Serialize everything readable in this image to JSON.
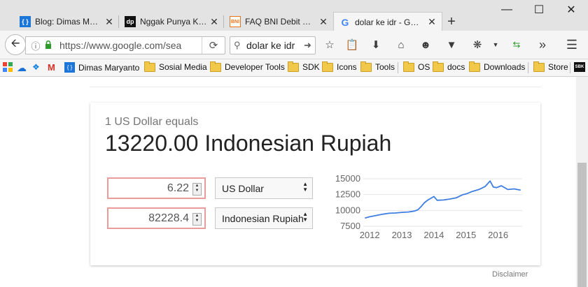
{
  "browser": {
    "tabs": [
      {
        "title": "Blog: Dimas M…",
        "favicon": "brackets-icon",
        "active": false
      },
      {
        "title": "Nggak Punya K…",
        "favicon": "dp-logo-icon",
        "active": false
      },
      {
        "title": "FAQ BNI Debit …",
        "favicon": "bni-logo-icon",
        "active": false
      },
      {
        "title": "dolar ke idr - G…",
        "favicon": "google-g-icon",
        "active": true
      }
    ],
    "url": "https://www.google.com/sea",
    "search_query": "dolar ke idr",
    "window_controls": {
      "minimize": "—",
      "maximize": "☐",
      "close": "✕"
    }
  },
  "bookmarks": [
    {
      "label": "Dimas Maryanto",
      "type": "site"
    },
    {
      "label": "Sosial Media",
      "type": "folder"
    },
    {
      "label": "Developer Tools",
      "type": "folder"
    },
    {
      "label": "SDK",
      "type": "folder"
    },
    {
      "label": "Icons",
      "type": "folder"
    },
    {
      "label": "Tools",
      "type": "folder"
    },
    {
      "label": "OS",
      "type": "folder"
    },
    {
      "label": "docs",
      "type": "folder"
    },
    {
      "label": "Downloads",
      "type": "folder"
    },
    {
      "label": "Store",
      "type": "folder"
    }
  ],
  "converter": {
    "equals_text": "1 US Dollar equals",
    "result_text": "13220.00 Indonesian Rupiah",
    "from_amount": "6.22",
    "from_currency": "US Dollar",
    "to_amount": "82228.4",
    "to_currency": "Indonesian Rupiah",
    "disclaimer": "Disclaimer"
  },
  "chart_data": {
    "type": "line",
    "title": "",
    "xlabel": "",
    "ylabel": "",
    "x_ticks": [
      "2012",
      "2013",
      "2014",
      "2015",
      "2016"
    ],
    "y_ticks": [
      "7500",
      "10000",
      "12500",
      "15000"
    ],
    "ylim": [
      7500,
      15000
    ],
    "xlim": [
      2011.8,
      2016.75
    ],
    "color": "#3d7ee0",
    "grid": true,
    "series": [
      {
        "x": [
          2011.85,
          2012.0,
          2012.2,
          2012.4,
          2012.6,
          2012.8,
          2013.0,
          2013.2,
          2013.4,
          2013.5,
          2013.6,
          2013.7,
          2013.8,
          2013.9,
          2014.0,
          2014.1,
          2014.3,
          2014.5,
          2014.7,
          2014.9,
          2015.0,
          2015.2,
          2015.4,
          2015.6,
          2015.75,
          2015.85,
          2015.95,
          2016.1,
          2016.3,
          2016.5,
          2016.7
        ],
        "y": [
          8800,
          9000,
          9200,
          9400,
          9550,
          9600,
          9700,
          9750,
          9900,
          10100,
          10600,
          11200,
          11600,
          11900,
          12200,
          11600,
          11650,
          11800,
          12000,
          12500,
          12600,
          13000,
          13300,
          13800,
          14650,
          13700,
          13600,
          13900,
          13300,
          13400,
          13200
        ]
      }
    ]
  }
}
